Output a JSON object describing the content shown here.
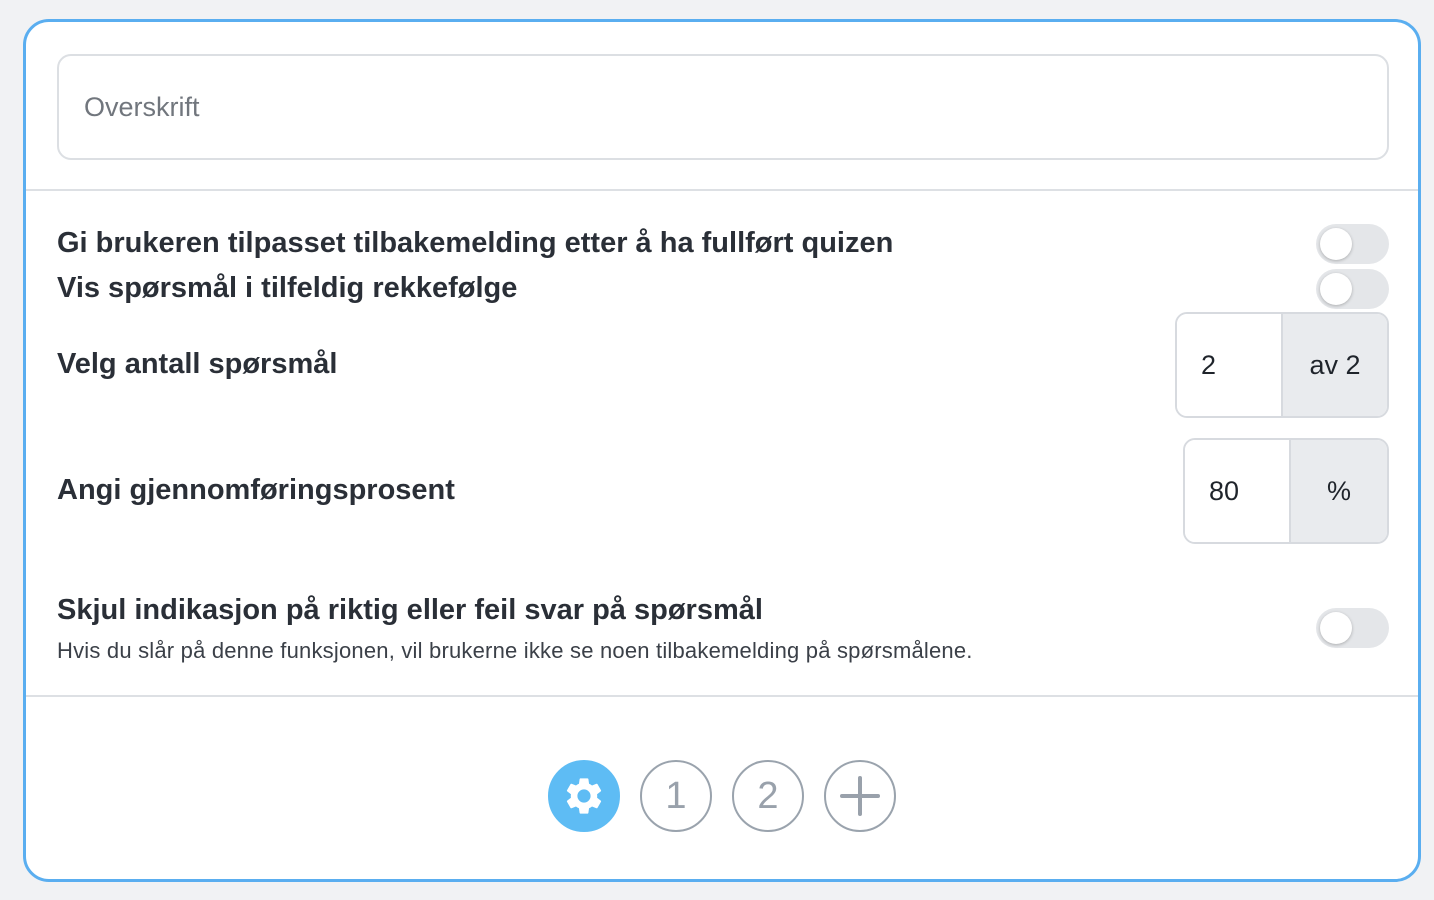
{
  "header": {
    "title_placeholder": "Overskrift",
    "title_value": ""
  },
  "settings": {
    "feedback_toggle": {
      "label": "Gi brukeren tilpasset tilbakemelding etter å ha fullført quizen",
      "enabled": false
    },
    "random_order_toggle": {
      "label": "Vis spørsmål i tilfeldig rekkefølge",
      "enabled": false
    },
    "question_count": {
      "label": "Velg antall spørsmål",
      "value": "2",
      "suffix": "av 2"
    },
    "pass_percentage": {
      "label": "Angi gjennomføringsprosent",
      "value": "80",
      "suffix": "%"
    },
    "hide_indication_toggle": {
      "label": "Skjul indikasjon på riktig eller feil svar på spørsmål",
      "description": "Hvis du slår på denne funksjonen, vil brukerne ikke se noen tilbakemelding på spørsmålene.",
      "enabled": false
    }
  },
  "stepper": {
    "settings_icon": "gear-icon",
    "steps": [
      "1",
      "2"
    ],
    "add_icon": "plus-icon"
  },
  "colors": {
    "card_border": "#5aaef0",
    "active_step": "#5ebcf4",
    "toggle_off": "#e4e6e9"
  }
}
